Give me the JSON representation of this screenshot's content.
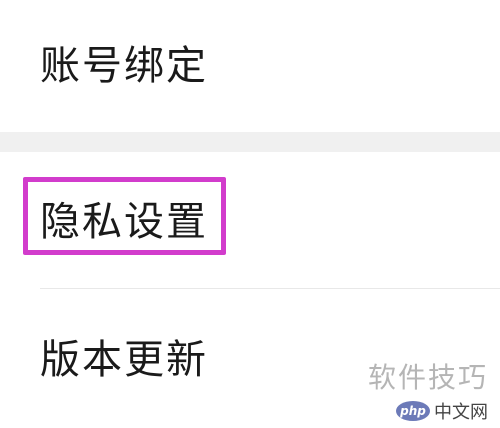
{
  "settings": {
    "items": [
      {
        "label": "账号绑定"
      },
      {
        "label": "隐私设置",
        "highlighted": true
      },
      {
        "label": "版本更新"
      }
    ],
    "highlight_color": "#d23ccc"
  },
  "watermark": {
    "text": "软件技巧",
    "logo_badge": "php",
    "logo_text": "中文网"
  }
}
